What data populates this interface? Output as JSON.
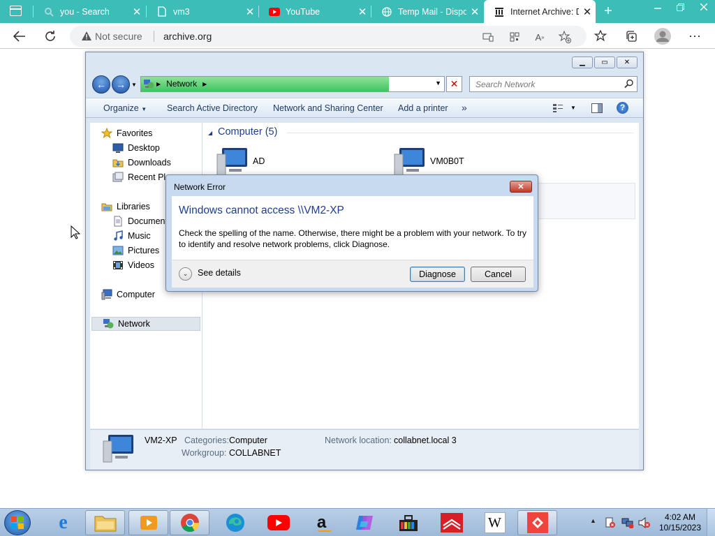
{
  "browser": {
    "tabs": [
      {
        "title": "you - Search",
        "icon": "search-icon"
      },
      {
        "title": "vm3",
        "icon": "document-icon"
      },
      {
        "title": "YouTube",
        "icon": "youtube-icon"
      },
      {
        "title": "Temp Mail - Disposable",
        "icon": "globe-icon"
      },
      {
        "title": "Internet Archive: D",
        "icon": "archive-icon"
      }
    ],
    "security_label": "Not secure",
    "url": "archive.org"
  },
  "explorer": {
    "address_path": "Network",
    "search_placeholder": "Search Network",
    "toolbar": {
      "organize": "Organize",
      "search_ad": "Search Active Directory",
      "network_center": "Network and Sharing Center",
      "add_printer": "Add a printer",
      "more": "»"
    },
    "sidebar": {
      "favorites": "Favorites",
      "desktop": "Desktop",
      "downloads": "Downloads",
      "recent_places": "Recent Places",
      "libraries": "Libraries",
      "documents": "Documents",
      "music": "Music",
      "pictures": "Pictures",
      "videos": "Videos",
      "computer": "Computer",
      "network": "Network"
    },
    "group_header": "Computer (5)",
    "computers": [
      "AD",
      "VM0B0T"
    ],
    "status": {
      "name": "VM2-XP",
      "categories_label": "Categories:",
      "categories_value": "Computer",
      "workgroup_label": "Workgroup:",
      "workgroup_value": "COLLABNET",
      "network_location_label": "Network location:",
      "network_location_value": "collabnet.local 3"
    }
  },
  "dialog": {
    "title": "Network Error",
    "heading": "Windows cannot access \\\\VM2-XP",
    "message": "Check the spelling of the name. Otherwise, there might be a problem with your network. To try to identify and resolve network problems, click Diagnose.",
    "see_details": "See details",
    "diagnose": "Diagnose",
    "cancel": "Cancel"
  },
  "taskbar": {
    "time": "4:02 AM",
    "date": "10/15/2023"
  },
  "colors": {
    "browser_accent": "#3dbdb8",
    "dialog_heading": "#1e3d8f",
    "address_progress": "#3fc460"
  }
}
